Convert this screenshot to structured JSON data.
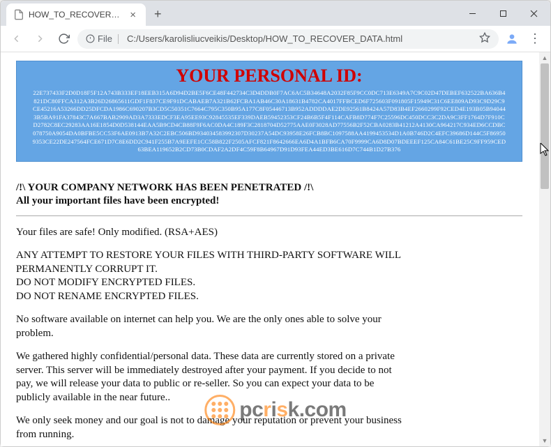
{
  "tab": {
    "title": "HOW_TO_RECOVER_DATA.html"
  },
  "addressbar": {
    "file_label": "File",
    "url": "C:/Users/karolisliucveikis/Desktop/HOW_TO_RECOVER_DATA.html"
  },
  "idbox": {
    "title": "YOUR PERSONAL ID:",
    "hex": "22E737433F2D0D18F5F12A743B333EF18EEB315A6D94D2BE5F6CE48F442734C3D4DDB0F7AC6AC5B34648A2032F85F9CC0DC713E6349A7C9C02D47DEBEF632522BA636B4821DC80FFCA312A3B26D26865611GDF1F837CE9F91DCABAEB7A321B62FCBA1AB46C30A18631B4782CA4017FFBCED6F725603F091805F15949C31C6EE809AD93C9D29C9CE45216A53266DD25DFCDA1986C690207B3CD5C50351C7664C795C350B95A177C8F05446713B952ADDDDAE2DE92561B8424A57D83B4EF2660299F92CED4E193B05B940443B5BA91FA37843C7A667BAB2909AD3A7333EDCF3EA95EE93C92845535EF339DAEB59452353CF24B6B5F4F114CAFB8D774F7C25596DC450DCC3C2DA9C3FF1764D7F910CD2782C8EC29283AA16E1854D0D538144EAA5B9CD4CB88F9F6AC0DA4C189F3C2818704D52775AAE0F3028AD77556B2F52CBA0283B41212A4130CA964217C934ED6CCDBC078750A9054DA0BFBE5CC53F6AE0913B7A32C2EBC506BD934034583992307D30237A54DC93958E26FCB8BC1097588AA4199453534D1A0B746D2C4EFC39686D144C5F869509353CE22DE247564FCE671D7C8E6DD2C941F255B7A9EEFE1CC58B822F2505AFCF821F8642666EA6D4A1BFB6CA70F9999CA6D8D07BDEEEF125CA84C61BE25C9FF959CED63BEA119652B2CD73B0CDAF2A2DF4C59F8B64967D91D93FEA44ED3BE616D7C744B1D27B376"
  },
  "body": {
    "heading1": "/!\\ YOUR COMPANY NETWORK HAS BEEN PENETRATED /!\\",
    "heading2": "All your important files have been encrypted!",
    "p1": "Your files are safe! Only modified. (RSA+AES)",
    "p2": "ANY ATTEMPT TO RESTORE YOUR FILES WITH THIRD-PARTY SOFTWARE WILL PERMANENTLY CORRUPT IT.\nDO NOT MODIFY ENCRYPTED FILES.\nDO NOT RENAME ENCRYPTED FILES.",
    "p3": "No software available on internet can help you. We are the only ones able to solve your problem.",
    "p4": "We gathered highly confidential/personal data. These data are currently stored on a private server. This server will be immediately destroyed after your payment. If you decide to not pay, we will release your data to public or re-seller. So you can expect your data to be publicly available in the near future..",
    "p5": "We only seek money and our goal is not to damage your reputation or prevent your business from running."
  },
  "watermark": {
    "text_prefix": "pc",
    "text_r": "r",
    "text_i": "i",
    "text_s": "s",
    "text_suffix": "k.com"
  }
}
